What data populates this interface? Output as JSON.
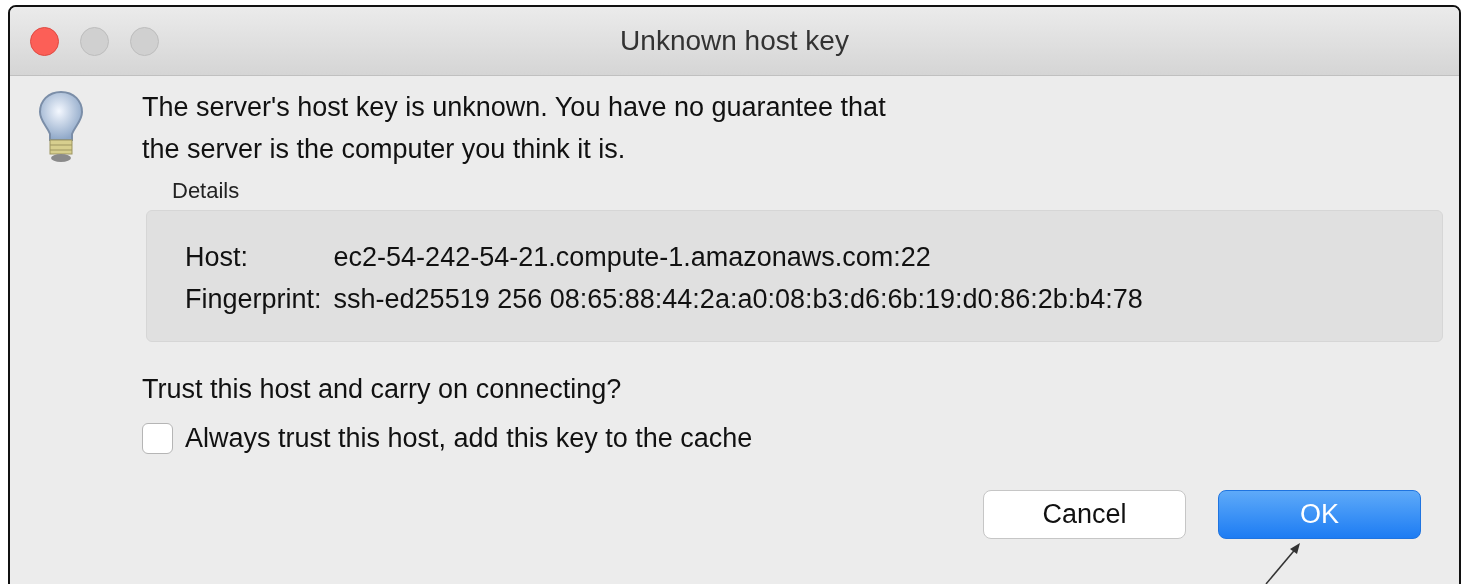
{
  "window": {
    "title": "Unknown host key"
  },
  "message": [
    "The server's host key is unknown. You have no guarantee that",
    "the server is the computer you think it is."
  ],
  "details": {
    "label": "Details",
    "rows": [
      {
        "key": "Host:",
        "value": "ec2-54-242-54-21.compute-1.amazonaws.com:22"
      },
      {
        "key": "Fingerprint:",
        "value": "ssh-ed25519 256 08:65:88:44:2a:a0:08:b3:d6:6b:19:d0:86:2b:b4:78"
      }
    ]
  },
  "question": "Trust this host and carry on connecting?",
  "checkbox": {
    "label": "Always trust this host, add this key to the cache",
    "checked": false
  },
  "buttons": [
    {
      "label": "Cancel",
      "kind": "secondary"
    },
    {
      "label": "OK",
      "kind": "primary"
    }
  ]
}
